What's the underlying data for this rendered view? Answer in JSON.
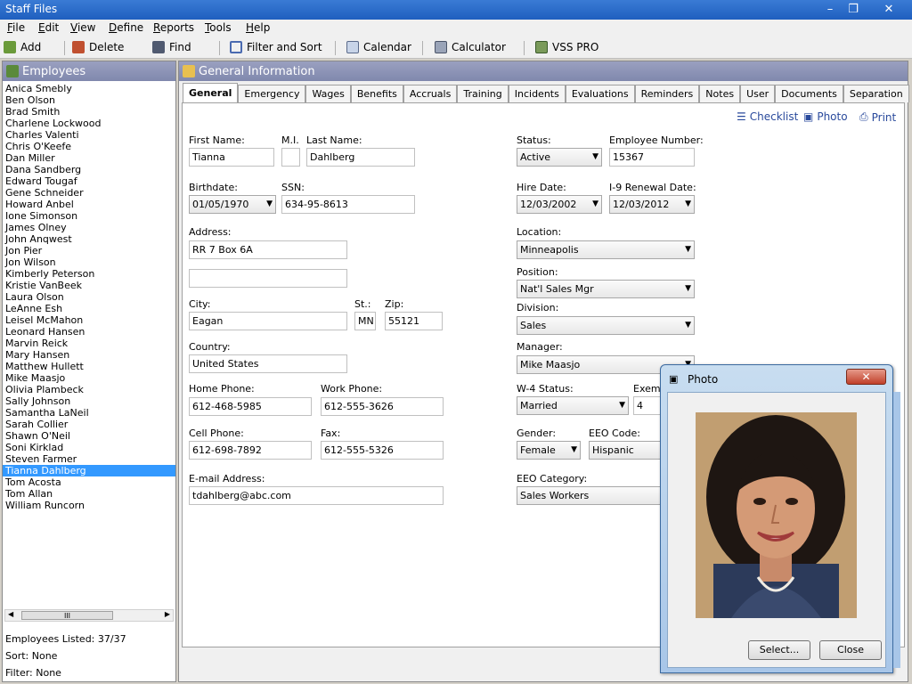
{
  "window": {
    "title": "Staff Files",
    "minimize": "–",
    "restore": "❐",
    "close": "✕"
  },
  "menu": [
    "File",
    "Edit",
    "View",
    "Define",
    "Reports",
    "Tools",
    "Help"
  ],
  "toolbar": {
    "add": "Add",
    "delete": "Delete",
    "find": "Find",
    "filter_sort": "Filter and Sort",
    "calendar": "Calendar",
    "calculator": "Calculator",
    "vss_pro": "VSS PRO"
  },
  "employees_panel": {
    "title": "Employees",
    "items": [
      "Anica Smebly",
      "Ben Olson",
      "Brad Smith",
      "Charlene Lockwood",
      "Charles Valenti",
      "Chris O'Keefe",
      "Dan Miller",
      "Dana Sandberg",
      "Edward Tougaf",
      "Gene Schneider",
      "Howard Anbel",
      "Ione Simonson",
      "James Olney",
      "John Anqwest",
      "Jon Pier",
      "Jon Wilson",
      "Kimberly Peterson",
      "Kristie VanBeek",
      "Laura Olson",
      "LeAnne Esh",
      "Leisel McMahon",
      "Leonard Hansen",
      "Marvin Reick",
      "Mary Hansen",
      "Matthew Hullett",
      "Mike Maasjo",
      "Olivia Plambeck",
      "Sally Johnson",
      "Samantha LaNeil",
      "Sarah Collier",
      "Shawn O'Neil",
      "Soni Kirklad",
      "Steven Farmer",
      "Tianna Dahlberg",
      "Tom Acosta",
      "Tom Allan",
      "William Runcorn"
    ],
    "selected_index": 33,
    "scroll_thumb": "III",
    "listed": "Employees Listed: 37/37",
    "sort": "Sort: None",
    "filter": "Filter: None"
  },
  "general_panel": {
    "title": "General Information",
    "tabs": [
      "General",
      "Emergency",
      "Wages",
      "Benefits",
      "Accruals",
      "Training",
      "Incidents",
      "Evaluations",
      "Reminders",
      "Notes",
      "User",
      "Documents",
      "Separation"
    ],
    "links": {
      "checklist": "Checklist",
      "photo": "Photo",
      "print": "Print"
    }
  },
  "form": {
    "first_name_label": "First Name:",
    "first_name": "Tianna",
    "mi_label": "M.I.",
    "mi": "",
    "last_name_label": "Last Name:",
    "last_name": "Dahlberg",
    "birthdate_label": "Birthdate:",
    "birthdate": "01/05/1970",
    "ssn_label": "SSN:",
    "ssn": "634-95-8613",
    "address_label": "Address:",
    "address1": "RR 7 Box 6A",
    "address2": "",
    "city_label": "City:",
    "city": "Eagan",
    "state_label": "St.:",
    "state": "MN",
    "zip_label": "Zip:",
    "zip": "55121",
    "country_label": "Country:",
    "country": "United States",
    "home_phone_label": "Home Phone:",
    "home_phone": "612-468-5985",
    "work_phone_label": "Work Phone:",
    "work_phone": "612-555-3626",
    "cell_phone_label": "Cell Phone:",
    "cell_phone": "612-698-7892",
    "fax_label": "Fax:",
    "fax": "612-555-5326",
    "email_label": "E-mail Address:",
    "email": "tdahlberg@abc.com",
    "status_label": "Status:",
    "status": "Active",
    "emp_num_label": "Employee Number:",
    "emp_num": "15367",
    "hire_date_label": "Hire Date:",
    "hire_date": "12/03/2002",
    "i9_label": "I-9 Renewal Date:",
    "i9": "12/03/2012",
    "location_label": "Location:",
    "location": "Minneapolis",
    "position_label": "Position:",
    "position": "Nat'l Sales Mgr",
    "division_label": "Division:",
    "division": "Sales",
    "manager_label": "Manager:",
    "manager": "Mike Maasjo",
    "w4_label": "W-4 Status:",
    "w4": "Married",
    "exempt_label": "Exemp",
    "exempt": "4",
    "gender_label": "Gender:",
    "gender": "Female",
    "eeo_code_label": "EEO Code:",
    "eeo_code": "Hispanic",
    "eeo_cat_label": "EEO Category:",
    "eeo_cat": "Sales Workers"
  },
  "photo_dialog": {
    "title": "Photo",
    "close_x": "✕",
    "select": "Select...",
    "close": "Close"
  },
  "colors": {
    "title_bar": "#1f5fbf",
    "panel_header": "#8088ad",
    "selection": "#3399ff",
    "link": "#2a4a9c"
  }
}
